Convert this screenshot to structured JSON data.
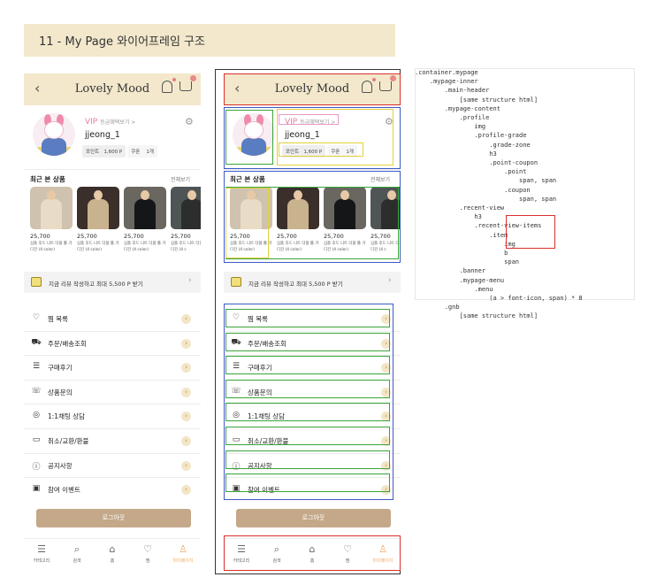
{
  "page_title": "11 - My Page 와이어프레임 구조",
  "header": {
    "back": "‹",
    "brand": "Lovely Mood"
  },
  "profile": {
    "grade": "VIP",
    "grade_link": "등급혜택보기 >",
    "username": "jjeong_1",
    "points_label": "포인트",
    "points_value": "1,600 P",
    "coupon_label": "쿠폰",
    "coupon_value": "1개"
  },
  "recent": {
    "title": "최근 본 상품",
    "more": "전체보기",
    "items": [
      {
        "price": "25,700",
        "desc": "심플 후드 니트 더플 롤 가디건 (4 color)"
      },
      {
        "price": "25,700",
        "desc": "심플 후드 니트 더플 롤 가디건 (4 color)"
      },
      {
        "price": "25,700",
        "desc": "심플 후드 니트 더플 롤 가디건 (4 color)"
      },
      {
        "price": "25,700",
        "desc": "심플 후드 니트 더플 롤 가디건 (4 c"
      }
    ]
  },
  "banner": {
    "text": "지금 리뷰 작성하고 최대 5,500 P 받기",
    "arrow": "›"
  },
  "menu": [
    {
      "icon": "♡",
      "label": "찜 목록"
    },
    {
      "icon": "⛟",
      "label": "주문/배송조회"
    },
    {
      "icon": "☰",
      "label": "구매후기"
    },
    {
      "icon": "☏",
      "label": "상품문의"
    },
    {
      "icon": "◎",
      "label": "1:1채팅 상담"
    },
    {
      "icon": "▭",
      "label": "취소/교환/환불"
    },
    {
      "icon": "ⓘ",
      "label": "공지사항"
    },
    {
      "icon": "▣",
      "label": "참여 이벤트"
    }
  ],
  "logout": "로그아웃",
  "gnb": [
    {
      "icon": "☰",
      "label": "카테고리"
    },
    {
      "icon": "⌕",
      "label": "검색"
    },
    {
      "icon": "⌂",
      "label": "홈"
    },
    {
      "icon": "♡",
      "label": "찜"
    },
    {
      "icon": "♙",
      "label": "마이페이지"
    }
  ],
  "code_lines": [
    ".container.mypage",
    "    .mypage-inner",
    "        .main-header",
    "            [same structure html]",
    "        .mypage-content",
    "            .profile",
    "                img",
    "                .profile-grade",
    "                    .grade-zone",
    "                    h3",
    "                    .point-coupon",
    "                        .point",
    "                            span, span",
    "                        .coupon",
    "                            span, span",
    "            .recent-view",
    "                h3",
    "                .recent-view-items",
    "                    .item",
    "                        img",
    "                        b",
    "                        span",
    "            .banner",
    "            .mypage-menu",
    "                .menu",
    "                    (a > font-icon, span) * 8",
    "        .gnb",
    "            [same structure html]"
  ],
  "colors": {
    "header_bg": "#f3e8cc",
    "accent": "#f0ab68",
    "logout_bg": "#c4a889",
    "wire_red": "#d9302c",
    "wire_blue": "#3d5ac4",
    "wire_green": "#3aa43a",
    "wire_yellow": "#e3d03c"
  }
}
